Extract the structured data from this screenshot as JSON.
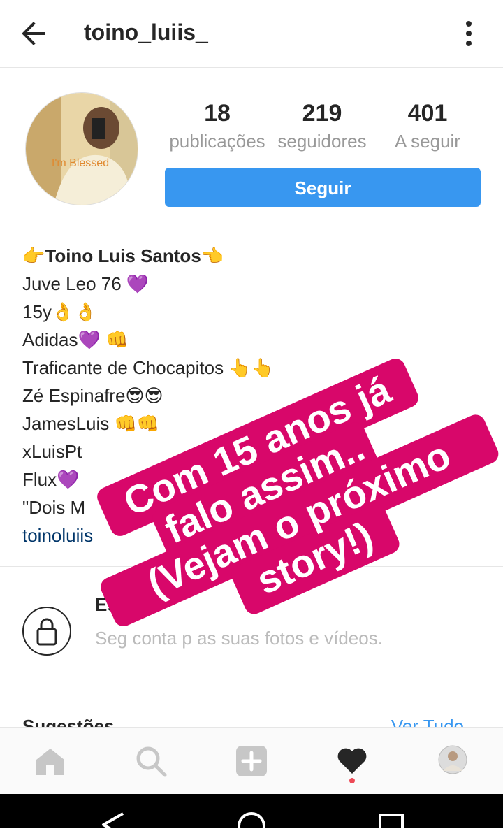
{
  "header": {
    "username": "toino_luiis_",
    "back_icon": "arrow-left-icon",
    "more_icon": "more-vertical-icon"
  },
  "profile": {
    "avatar_text": "I'm Blessed",
    "stats": [
      {
        "value": "18",
        "label": "publicações"
      },
      {
        "value": "219",
        "label": "seguidores"
      },
      {
        "value": "401",
        "label": "A seguir"
      }
    ],
    "follow_label": "Seguir"
  },
  "bio": {
    "name": "👉Toino Luis Santos👈",
    "lines": [
      "Juve Leo 76 💜",
      "15y👌👌",
      "Adidas💜 👊",
      "Traficante de Chocapitos 👆👆",
      "Zé Espinafre😎😎",
      "JamesLuis 👊👊",
      "xLuisPt",
      "Flux💜",
      "\"Dois M"
    ],
    "link": "toinoluiis"
  },
  "private": {
    "title": "Es",
    "text": "Seg         conta p          as suas fotos e vídeos."
  },
  "suggestions": {
    "title": "Sugestões",
    "see_all": "Ver Tudo"
  },
  "nav": {
    "items": [
      "home-icon",
      "search-icon",
      "add-icon",
      "heart-icon",
      "profile-avatar-icon"
    ]
  },
  "story_sticker": {
    "lines": [
      "Com 15 anos já",
      "falo assim..",
      "(Vejam o próximo",
      "story!)"
    ]
  },
  "colors": {
    "accent": "#3897f0",
    "sticker": "#d8076a"
  }
}
